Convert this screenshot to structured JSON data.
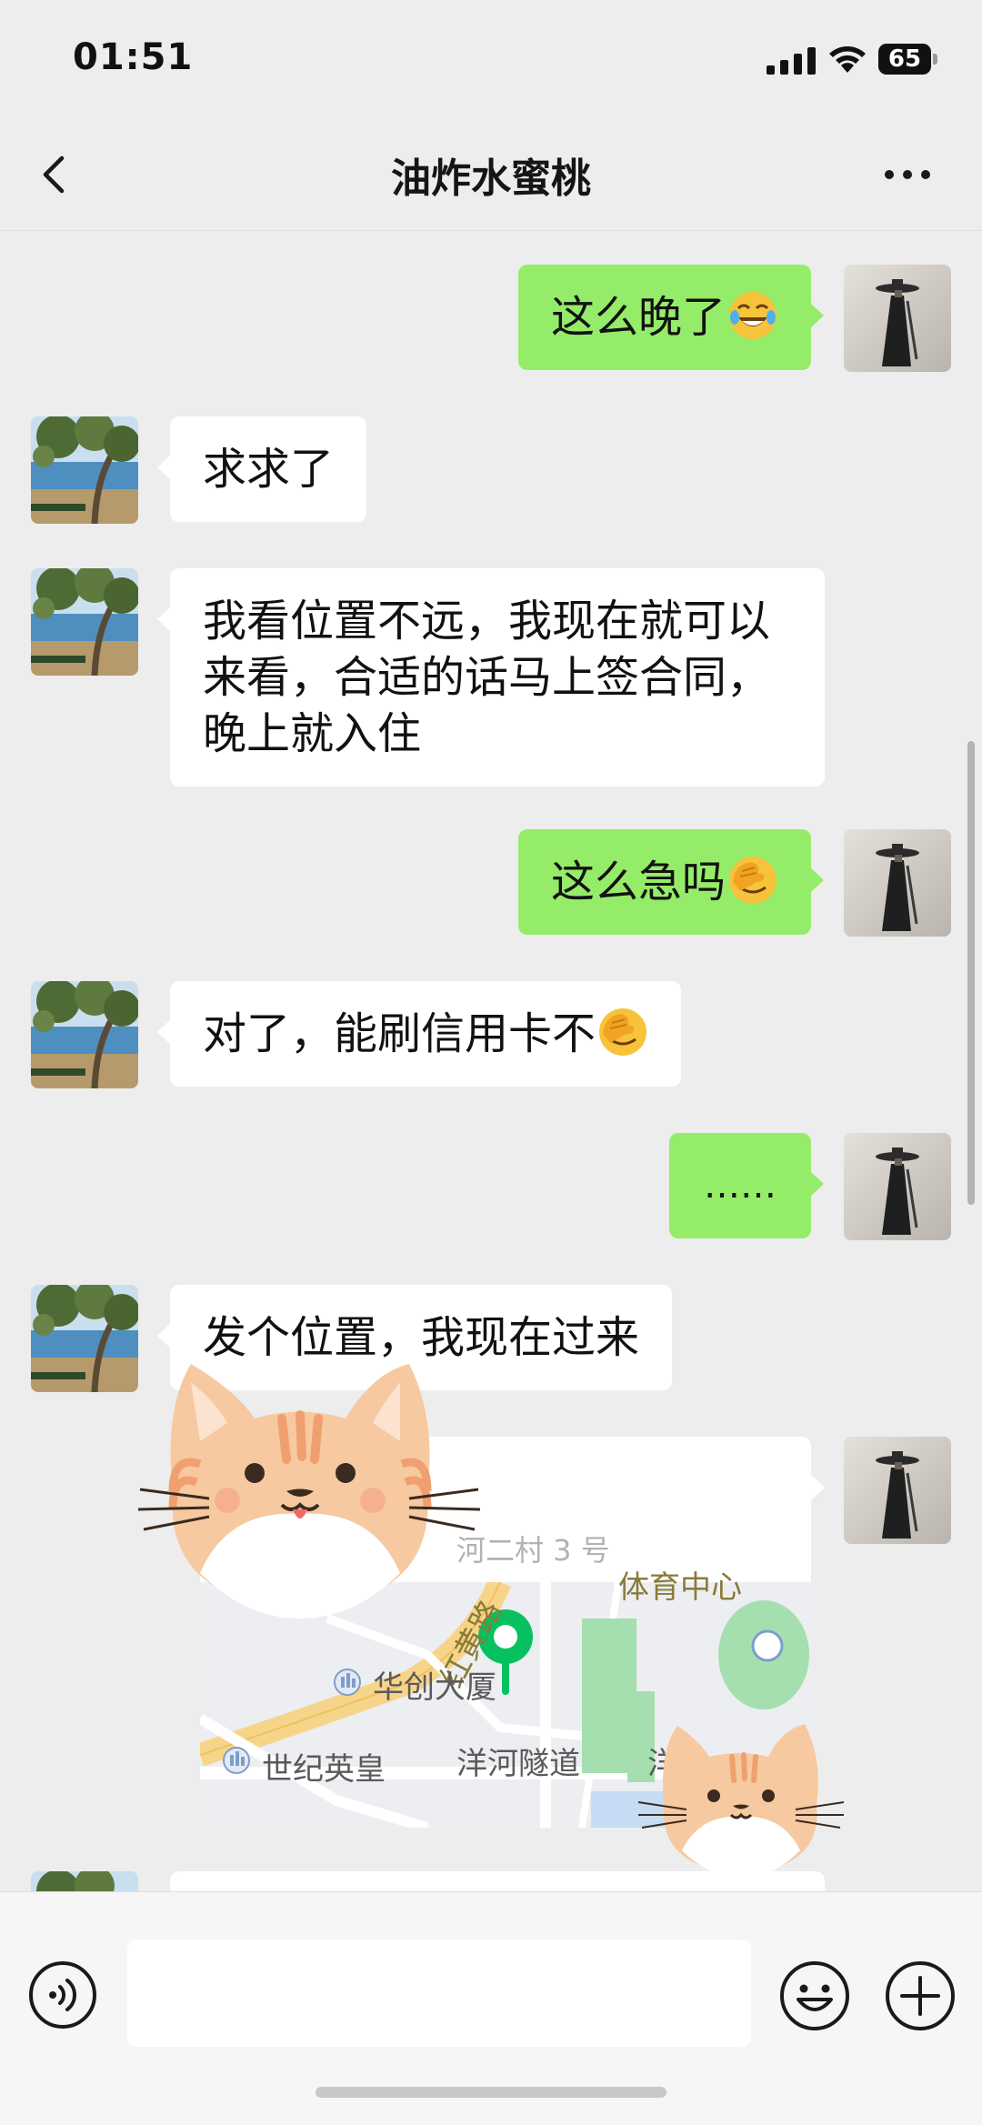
{
  "status_bar": {
    "time": "01:51",
    "battery_level": "65",
    "battery_fraction": 0.65,
    "icons": [
      "signal-icon",
      "wifi-icon",
      "battery-icon"
    ]
  },
  "nav": {
    "title": "油炸水蜜桃",
    "back_icon": "chevron-left-icon",
    "more_icon": "more-dots-icon"
  },
  "messages": [
    {
      "side": "right",
      "text": "这么晚了",
      "emoji": "tears-of-joy-emoji"
    },
    {
      "side": "left",
      "text": "求求了"
    },
    {
      "side": "left",
      "lines": [
        "我看位置不远，我现在就可以",
        "来看，合适的话马上签合同，",
        "晚上就入住"
      ]
    },
    {
      "side": "right",
      "text": "这么急吗",
      "emoji": "facepalm-emoji"
    },
    {
      "side": "left",
      "text": "对了，能刷信用卡不",
      "emoji": "facepalm-emoji"
    },
    {
      "side": "right",
      "text": "……"
    },
    {
      "side": "left",
      "text": "发个位置，我现在过来"
    }
  ],
  "location_card": {
    "name": "",
    "address": "河二村 3 号",
    "map_labels": {
      "road": "红黄路",
      "building": "华创大厦",
      "tunnel": "洋河隧道",
      "mall": "世纪英皇",
      "sports": "体育中心",
      "tunnel_cut": "洋"
    }
  },
  "input_bar": {
    "placeholder": "",
    "icons": [
      "voice-icon",
      "emoji-icon",
      "plus-icon"
    ]
  },
  "colors": {
    "background": "#ededed",
    "my_bubble": "#95ec69",
    "their_bubble": "#ffffff",
    "pin": "#07c160"
  }
}
